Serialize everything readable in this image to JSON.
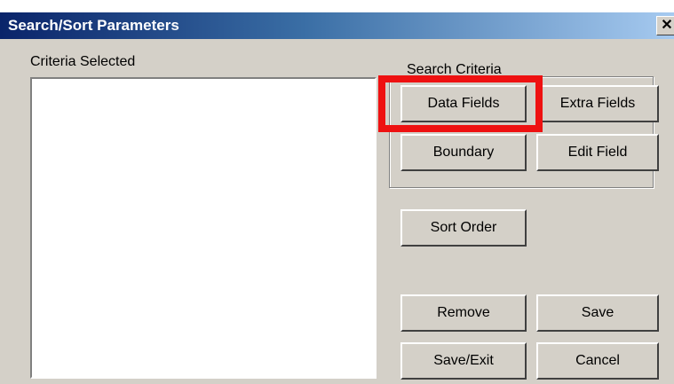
{
  "window": {
    "title": "Search/Sort Parameters",
    "close_glyph": "✕"
  },
  "criteria_selected": {
    "label": "Criteria Selected",
    "items": []
  },
  "search_criteria": {
    "label": "Search Criteria",
    "data_fields_label": "Data Fields",
    "extra_fields_label": "Extra Fields",
    "boundary_label": "Boundary",
    "edit_field_label": "Edit Field"
  },
  "buttons": {
    "sort_order_label": "Sort Order",
    "remove_label": "Remove",
    "save_label": "Save",
    "save_exit_label": "Save/Exit",
    "cancel_label": "Cancel"
  },
  "colors": {
    "highlight_box": "#ee1111",
    "titlebar_start": "#0a246a",
    "titlebar_end": "#a6caf0",
    "dialog_face": "#d4d0c8"
  }
}
